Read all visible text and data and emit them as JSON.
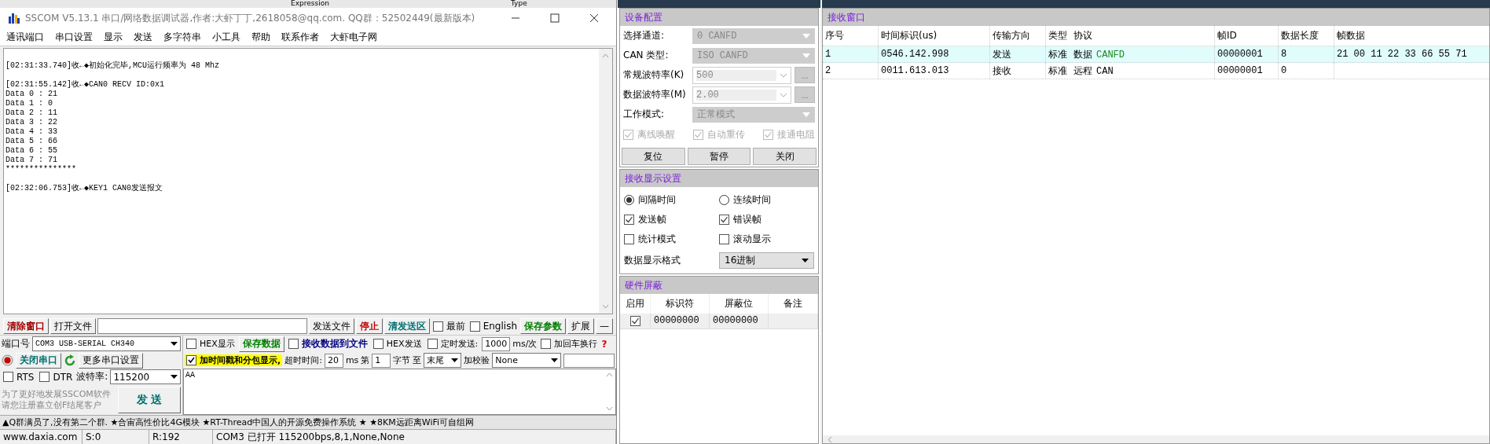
{
  "background_window": {
    "columns": [
      "Expression",
      "Type"
    ]
  },
  "window": {
    "title": "SSCOM V5.13.1 串口/网络数据调试器,作者:大虾丁丁,2618058@qq.com. QQ群：52502449(最新版本)",
    "menu": [
      "通讯端口",
      "串口设置",
      "显示",
      "发送",
      "多字符串",
      "小工具",
      "帮助",
      "联系作者",
      "大虾电子网"
    ]
  },
  "log": {
    "messages": [
      {
        "header": "[02:31:33.740]收←◆初始化完毕,MCU运行频率为 48 Mhz"
      },
      {
        "header": "[02:31:55.142]收←◆CAN0 RECV ID:0x1",
        "lines": [
          "Data 0 : 21",
          "Data 1 : 0",
          "Data 2 : 11",
          "Data 3 : 22",
          "Data 4 : 33",
          "Data 5 : 66",
          "Data 6 : 55",
          "Data 7 : 71",
          "***************"
        ]
      },
      {
        "header": "[02:32:06.753]收←◆KEY1 CAN0发送报文"
      }
    ]
  },
  "toolbar": [
    {
      "kind": "button",
      "label": "清除窗口",
      "color": "#a00000"
    },
    {
      "kind": "button",
      "label": "打开文件"
    },
    {
      "kind": "path"
    },
    {
      "kind": "button",
      "label": "发送文件"
    },
    {
      "kind": "button",
      "label": "停止",
      "color": "#c00000"
    },
    {
      "kind": "button",
      "label": "清发送区",
      "color": "#007070"
    },
    {
      "kind": "checkbox",
      "label": "最前",
      "checked": false
    },
    {
      "kind": "checkbox",
      "label": "English",
      "checked": false
    },
    {
      "kind": "button",
      "label": "保存参数",
      "color": "#008000"
    },
    {
      "kind": "button",
      "label": "扩展"
    },
    {
      "kind": "button",
      "label": "—"
    }
  ],
  "port": {
    "label": "端口号",
    "value": "COM3 USB-SERIAL CH340",
    "open_button": "关闭串口",
    "more_button": "更多串口设置",
    "rts": {
      "label": "RTS",
      "checked": false
    },
    "dtr": {
      "label": "DTR",
      "checked": false
    },
    "baud_label": "波特率:",
    "baud": "115200",
    "notice": [
      "为了更好地发展SSCOM软件",
      "请您注册嘉立创F结尾客户"
    ],
    "send_button": "发  送"
  },
  "options_row_1": [
    {
      "kind": "checkbox",
      "label": "HEX显示",
      "checked": false
    },
    {
      "kind": "button",
      "label": "保存数据",
      "color": "#008000"
    },
    {
      "kind": "checkbox",
      "label": "接收数据到文件",
      "checked": false,
      "color": "#000080"
    },
    {
      "kind": "checkbox",
      "label": "HEX发送",
      "checked": false
    },
    {
      "kind": "checkbox",
      "label": "定时发送:",
      "checked": false
    },
    {
      "kind": "field",
      "value": "1000"
    },
    {
      "kind": "label",
      "label": "ms/次"
    },
    {
      "kind": "checkbox",
      "label": "加回车换行",
      "checked": false
    },
    {
      "kind": "help",
      "label": "?"
    }
  ],
  "options_row_2": [
    {
      "kind": "checkbox",
      "label": "加时间戳和分包显示,",
      "checked": true,
      "highlighted": true
    },
    {
      "kind": "label",
      "label": "超时时间:"
    },
    {
      "kind": "field",
      "value": "20"
    },
    {
      "kind": "label",
      "label": "ms"
    },
    {
      "kind": "label",
      "label": "第"
    },
    {
      "kind": "field",
      "value": "1"
    },
    {
      "kind": "label",
      "label": "字节"
    },
    {
      "kind": "label",
      "label": "至"
    },
    {
      "kind": "select",
      "value": "末尾"
    },
    {
      "kind": "label",
      "label": "加校验"
    },
    {
      "kind": "select",
      "value": "None"
    },
    {
      "kind": "field"
    }
  ],
  "send_text": {
    "value": "AA"
  },
  "marquee": "▲Q群满员了,没有第二个群. ★合宙高性价比4G模块 ★RT-Thread中国人的开源免费操作系统 ★ ★8KM远距离WiFi可自组网",
  "status_bar": [
    "www.daxia.com",
    "S:0",
    "R:192",
    "COM3 已打开  115200bps,8,1,None,None"
  ],
  "device_config": {
    "title": "设备配置",
    "fields": [
      {
        "kind": "select",
        "label": "选择通道:",
        "value": "0  CANFD",
        "disabled": true
      },
      {
        "kind": "select",
        "label": "CAN 类型:",
        "value": "ISO CANFD",
        "disabled": true
      },
      {
        "kind": "combo",
        "label": "常规波特率(K)",
        "value": "500",
        "more": "...",
        "disabled": true
      },
      {
        "kind": "combo",
        "label": "数据波特率(M)",
        "value": "2.00",
        "more": "...",
        "disabled": true
      },
      {
        "kind": "select",
        "label": "工作模式:",
        "value": "正常模式",
        "disabled": true
      }
    ],
    "options": [
      {
        "label": "离线唤醒",
        "checked": true,
        "disabled": true
      },
      {
        "label": "自动重传",
        "checked": true,
        "disabled": true
      },
      {
        "label": "接通电阻",
        "checked": true,
        "disabled": true
      }
    ],
    "buttons": [
      "复位",
      "暂停",
      "关闭"
    ]
  },
  "receive_display": {
    "title": "接收显示设置",
    "timing": [
      {
        "label": "间隔时间",
        "selected": true
      },
      {
        "label": "连续时间",
        "selected": false
      }
    ],
    "options": [
      {
        "label": "发送帧",
        "checked": true
      },
      {
        "label": "错误帧",
        "checked": true
      },
      {
        "label": "统计模式",
        "checked": false
      },
      {
        "label": "滚动显示",
        "checked": false
      }
    ],
    "format_label": "数据显示格式",
    "format": "16进制"
  },
  "hardware_filter": {
    "title": "硬件屏蔽",
    "columns": [
      "启用",
      "标识符",
      "屏蔽位",
      "备注"
    ],
    "rows": [
      {
        "enabled": true,
        "identifier": "00000000",
        "mask": "00000000"
      }
    ]
  },
  "receive_window": {
    "title": "接收窗口",
    "columns": [
      "序号",
      "时间标识(us)",
      "传输方向",
      "类型",
      "协议",
      "帧ID",
      "数据长度",
      "帧数据"
    ],
    "rows": [
      {
        "index": "1",
        "time": "0546.142.998",
        "direction": "发送",
        "type": "标准",
        "frame": "数据",
        "protocol": "CANFD",
        "color": "#1f8a1f",
        "id": "00000001",
        "length": "8",
        "data": "21 00 11 22 33 66 55 71",
        "selected": true
      },
      {
        "index": "2",
        "time": "0011.613.013",
        "direction": "接收",
        "type": "标准",
        "frame": "远程",
        "protocol": "CAN",
        "color": "#000000",
        "id": "00000001",
        "length": "0",
        "selected": false
      }
    ]
  }
}
